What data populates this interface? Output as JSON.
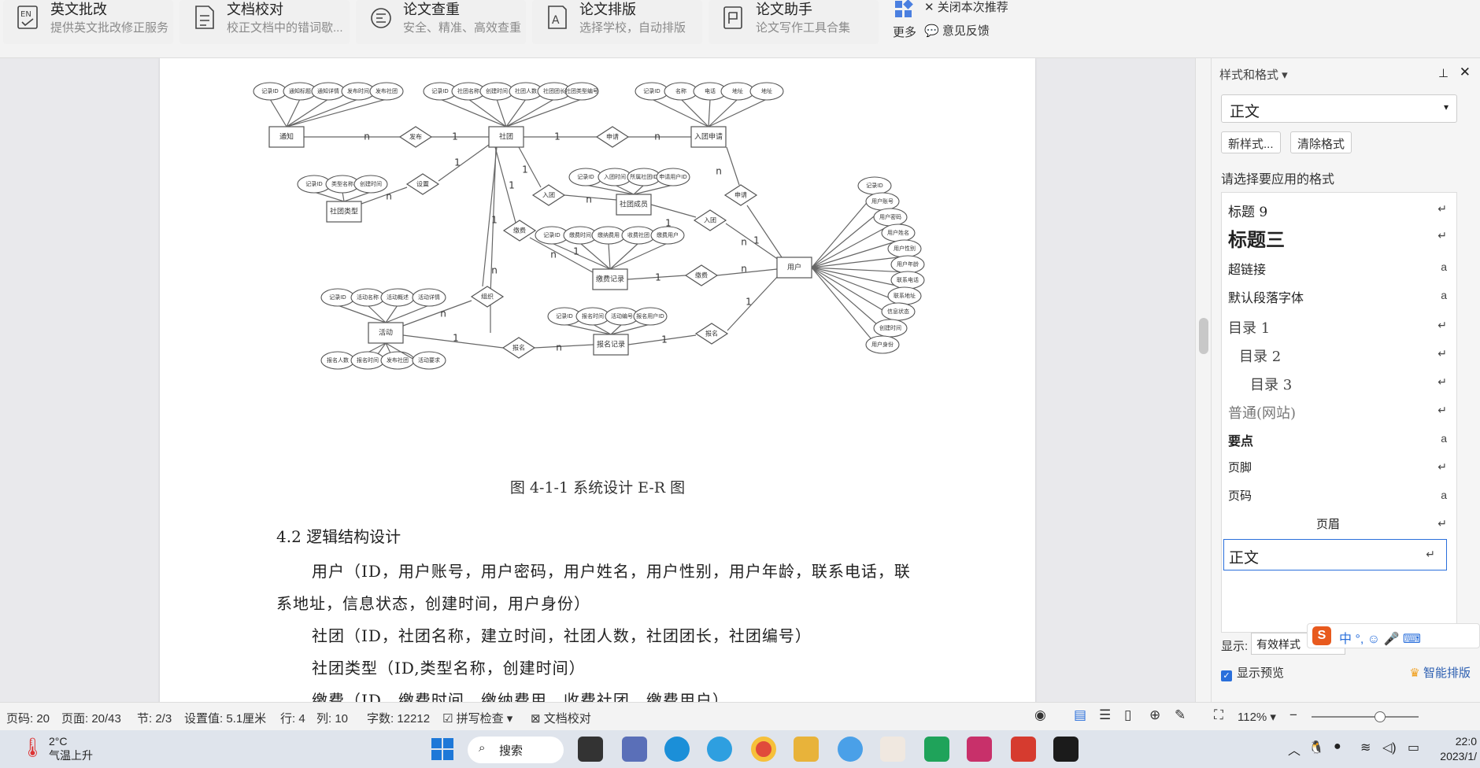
{
  "toolbar": {
    "tools": [
      {
        "name": "英文批改",
        "desc": "提供英文批改修正服务",
        "icon": "en-check-icon"
      },
      {
        "name": "文档校对",
        "desc": "校正文档中的错词歇...",
        "icon": "doc-proof-icon"
      },
      {
        "name": "论文查重",
        "desc": "安全、精准、高效查重",
        "icon": "dup-check-icon"
      },
      {
        "name": "论文排版",
        "desc": "选择学校，自动排版",
        "icon": "layout-icon"
      },
      {
        "name": "论文助手",
        "desc": "论文写作工具合集",
        "icon": "assistant-icon"
      }
    ],
    "more_label": "更多",
    "close_recommend": "关闭本次推荐",
    "feedback": "意见反馈"
  },
  "diagram": {
    "entities": [
      "通知",
      "社团",
      "入团申请",
      "社团类型",
      "社团成员",
      "缴费记录",
      "用户",
      "活动",
      "报名记录"
    ],
    "relations": [
      "发布",
      "申请",
      "设置",
      "入团",
      "缴费",
      "申请",
      "入团",
      "缴费",
      "组织",
      "报名",
      "报名"
    ],
    "attrs_notice": [
      "记录ID",
      "通知标题",
      "通知详情",
      "发布时间",
      "发布社团"
    ],
    "attrs_club": [
      "记录ID",
      "社团名称",
      "创建时间",
      "社团人数",
      "社团团长",
      "社团类型编号"
    ],
    "attrs_apply": [
      "记录ID",
      "名称",
      "电话",
      "地址",
      "地址"
    ],
    "attrs_type": [
      "记录ID",
      "类型名称",
      "创建时间"
    ],
    "attrs_member": [
      "记录ID",
      "入团时间",
      "所属社团ID",
      "申请用户ID"
    ],
    "attrs_fee": [
      "记录ID",
      "缴费时间",
      "缴纳费用",
      "收费社团",
      "缴费用户"
    ],
    "attrs_user": [
      "记录ID",
      "用户账号",
      "用户密码",
      "用户姓名",
      "用户性别",
      "用户年龄",
      "联系电话",
      "联系地址",
      "信息状态",
      "创建时间",
      "用户身份"
    ],
    "attrs_activity_top": [
      "记录ID",
      "活动名称",
      "活动概述",
      "活动详情"
    ],
    "attrs_activity_bottom": [
      "报名人数",
      "报名时间",
      "发布社团",
      "活动要求"
    ],
    "attrs_signup": [
      "记录ID",
      "报名时间",
      "活动编号",
      "报名用户ID"
    ],
    "cardinality": [
      "n",
      "1",
      "1",
      "n",
      "n",
      "1",
      "1",
      "n",
      "1",
      "n",
      "1",
      "n",
      "1",
      "n",
      "1",
      "1",
      "n",
      "1",
      "n",
      "n",
      "1",
      "n",
      "1",
      "1"
    ]
  },
  "document": {
    "caption": "图 4-1-1 系统设计 E-R 图",
    "section": "4.2 逻辑结构设计",
    "paragraphs": [
      "用户（ID，用户账号，用户密码，用户姓名，用户性别，用户年龄，联系电话，联",
      "系地址，信息状态，创建时间，用户身份）",
      "社团（ID，社团名称，建立时间，社团人数，社团团长，社团编号）",
      "社团类型（ID,类型名称，创建时间）",
      "缴费（ID，缴费时间，缴纳费用，收费社团，缴费用户）"
    ]
  },
  "panel": {
    "title": "样式和格式",
    "current_style": "正文",
    "new_style_btn": "新样式...",
    "clear_format_btn": "清除格式",
    "apply_label": "请选择要应用的格式",
    "styles": [
      {
        "name": "标题 9",
        "mark": "↵"
      },
      {
        "name": "标题三",
        "mark": "↵"
      },
      {
        "name": "超链接",
        "mark": "a"
      },
      {
        "name": "默认段落字体",
        "mark": "a"
      },
      {
        "name": "目录 1",
        "mark": "↵"
      },
      {
        "name": "目录 2",
        "mark": "↵"
      },
      {
        "name": "目录 3",
        "mark": "↵"
      },
      {
        "name": "普通(网站)",
        "mark": "↵"
      },
      {
        "name": "要点",
        "mark": "a"
      },
      {
        "name": "页脚",
        "mark": "↵"
      },
      {
        "name": "页码",
        "mark": "a"
      },
      {
        "name": "页眉",
        "mark": "↵"
      },
      {
        "name": "正文",
        "mark": "↵"
      }
    ],
    "show_label": "显示:",
    "show_value": "有效样式",
    "preview_label": "显示预览",
    "smart_layout": "智能排版"
  },
  "status": {
    "page_code": "页码: 20",
    "pages": "页面: 20/43",
    "section": "节: 2/3",
    "setting": "设置值: 5.1厘米",
    "row": "行: 4",
    "col": "列: 10",
    "words": "字数: 12212",
    "spell": "拼写检查",
    "proof": "文档校对",
    "zoom": "112%"
  },
  "taskbar": {
    "temp": "2°C",
    "weather": "气温上升",
    "search": "搜索",
    "time": "22:0",
    "date": "2023/1/"
  },
  "colors": {
    "accent": "#2a6fdb",
    "wps_red": "#d63b2f"
  }
}
